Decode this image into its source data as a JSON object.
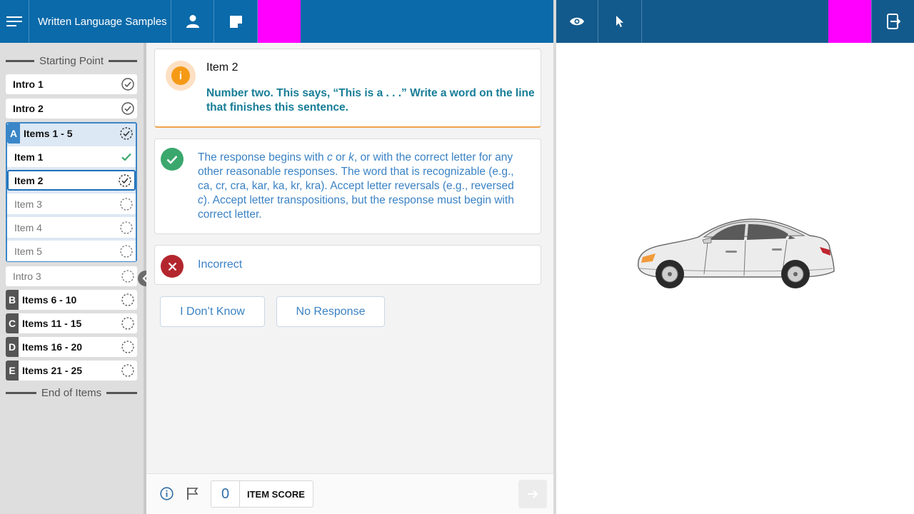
{
  "header": {
    "menu_icon": "hamburger-menu-icon",
    "title": "Written Language Samples",
    "examinee_icon": "person-icon",
    "notes_icon": "sticky-note-icon",
    "preview_icon": "eye-icon",
    "pointer_icon": "cursor-pointer-icon",
    "exit_icon": "device-exit-icon"
  },
  "sidebar": {
    "start_label": "Starting Point",
    "end_label": "End of Items",
    "intro1": "Intro 1",
    "intro2": "Intro 2",
    "intro3": "Intro 3",
    "groups": [
      {
        "letter": "A",
        "label": "Items 1 - 5"
      },
      {
        "letter": "B",
        "label": "Items 6 - 10"
      },
      {
        "letter": "C",
        "label": "Items 11 - 15"
      },
      {
        "letter": "D",
        "label": "Items 16 - 20"
      },
      {
        "letter": "E",
        "label": "Items 21 - 25"
      }
    ],
    "subitems": [
      "Item 1",
      "Item 2",
      "Item 3",
      "Item 4",
      "Item 5"
    ]
  },
  "item": {
    "title": "Item 2",
    "prompt": "Number two. This says, “This is a . . .” Write a word on the line that finishes this sentence."
  },
  "correct_response": {
    "text_before_c": "The response begins with ",
    "letter_c": "c",
    "text_or": " or ",
    "letter_k": "k",
    "text_mid": ", or with the correct letter for any other reasonable responses. The word that is recognizable (e.g., ca, cr, cra, kar, ka, kr, kra). Accept letter reversals (e.g., reversed ",
    "letter_c2": "c",
    "text_end": "). Accept letter transpositions, but the response must begin with correct letter."
  },
  "incorrect_label": "Incorrect",
  "buttons": {
    "dont_know": "I Don’t Know",
    "no_response": "No Response"
  },
  "footer": {
    "score_value": "0",
    "score_label": "ITEM SCORE"
  },
  "colors": {
    "topbar_left": "#0a6aaa",
    "topbar_right": "#135a8c",
    "magenta": "#ff00ff",
    "correct_green": "#3aa76d",
    "incorrect_red": "#b4262d",
    "info_orange": "#f59a16",
    "prompt_teal": "#177d97"
  },
  "stimulus": {
    "image": "car-illustration"
  }
}
